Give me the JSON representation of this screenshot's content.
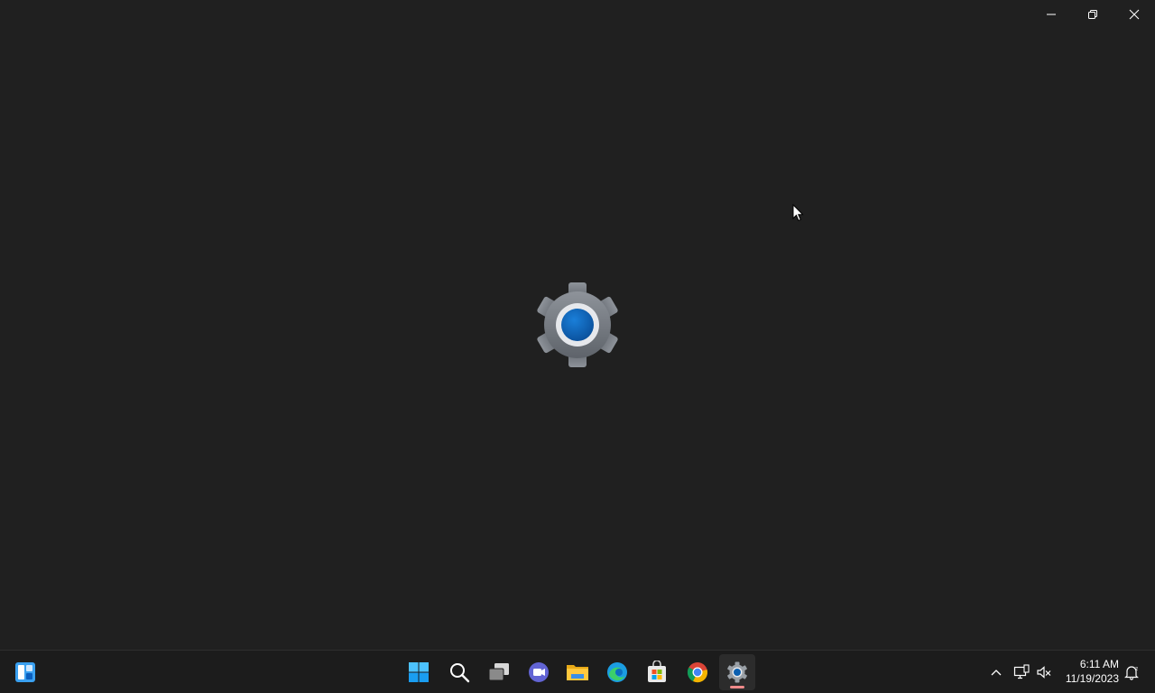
{
  "window": {
    "caption": {
      "minimize_icon": "minimize-icon",
      "restore_icon": "restore-icon",
      "close_icon": "close-icon"
    },
    "splash_icon": "settings-gear-icon"
  },
  "taskbar": {
    "widgets_icon": "widgets-icon",
    "apps": [
      {
        "icon": "windows-start-icon"
      },
      {
        "icon": "search-icon"
      },
      {
        "icon": "task-view-icon"
      },
      {
        "icon": "teams-chat-icon"
      },
      {
        "icon": "file-explorer-icon"
      },
      {
        "icon": "edge-icon"
      },
      {
        "icon": "microsoft-store-icon"
      },
      {
        "icon": "chrome-icon"
      },
      {
        "icon": "settings-icon",
        "active": true
      }
    ],
    "tray": {
      "chevron_icon": "chevron-up-icon",
      "network_icon": "network-icon",
      "volume_icon": "volume-muted-icon",
      "notification_icon": "notification-icon"
    },
    "clock": {
      "time": "6:11 AM",
      "date": "11/19/2023"
    }
  },
  "colors": {
    "background": "#202020",
    "taskbar": "#1c1c1c",
    "accent_blue": "#0067c0",
    "indicator": "#f08a8a"
  }
}
